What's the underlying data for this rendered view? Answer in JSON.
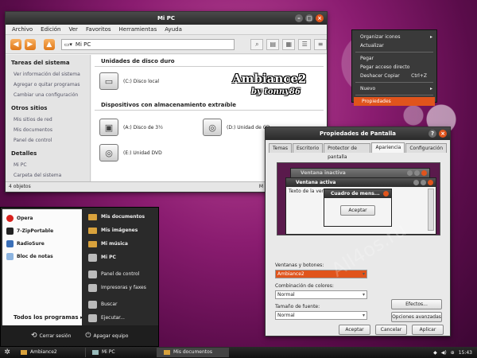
{
  "explorer": {
    "title": "Mi PC",
    "menu": [
      "Archivo",
      "Edición",
      "Ver",
      "Favoritos",
      "Herramientas",
      "Ayuda"
    ],
    "address": "Mi PC",
    "sidebar": {
      "tasks_header": "Tareas del sistema",
      "tasks": [
        "Ver información del sistema",
        "Agregar o quitar programas",
        "Cambiar una configuración"
      ],
      "other_header": "Otros sitios",
      "other": [
        "Mis sitios de red",
        "Mis documentos",
        "Panel de control"
      ],
      "details_header": "Detalles",
      "details": [
        "Mi PC",
        "Carpeta del sistema"
      ]
    },
    "hdd_header": "Unidades de disco duro",
    "local_disk": "(C:) Disco local",
    "removable_header": "Dispositivos con almacenamiento extraíble",
    "floppy": "(A:) Disco de 3½",
    "cd": "(D:) Unidad de CD",
    "dvd": "(E:) Unidad DVD",
    "status": "4 objetos",
    "status_right": "M"
  },
  "logo": {
    "title": "Ambiance2",
    "author": "by tonny86"
  },
  "context_menu": {
    "items": [
      "Organizar iconos",
      "Actualizar",
      "Pegar",
      "Pegar acceso directo",
      "Deshacer Copiar",
      "Nuevo",
      "Propiedades"
    ],
    "shortcut": "Ctrl+Z"
  },
  "display": {
    "title": "Propiedades de Pantalla",
    "tabs": [
      "Temas",
      "Escritorio",
      "Protector de pantalla",
      "Apariencia",
      "Configuración"
    ],
    "inactive_window": "Ventana inactiva",
    "active_window": "Ventana activa",
    "window_text": "Texto de la ventana",
    "message_box": "Cuadro de mens...",
    "accept_small": "Aceptar",
    "windows_label": "Ventanas y botones:",
    "windows_value": "Ambiance2",
    "colors_label": "Combinación de colores:",
    "colors_value": "Normal",
    "font_label": "Tamaño de fuente:",
    "font_value": "Normal",
    "effects": "Efectos...",
    "advanced": "Opciones avanzadas",
    "ok": "Aceptar",
    "cancel": "Cancelar",
    "apply": "Aplicar"
  },
  "start_menu": {
    "pinned": [
      "Opera",
      "7-ZipPortable",
      "RadioSure",
      "Bloc de notas"
    ],
    "all_programs": "Todos los programas",
    "right": [
      "Mis documentos",
      "Mis imágenes",
      "Mi música",
      "Mi PC",
      "Panel de control",
      "Impresoras y faxes",
      "Buscar",
      "Ejecutar..."
    ],
    "logoff": "Cerrar sesión",
    "shutdown": "Apagar equipo"
  },
  "taskbar": {
    "items": [
      "Ambiance2",
      "Mi PC",
      "Mis documentos"
    ],
    "clock": "15:43"
  },
  "watermark": "All4os.ru",
  "colors": {
    "accent": "#e0541c",
    "titlebar": "#2a2a2a",
    "desktop": "#8a1c70"
  }
}
